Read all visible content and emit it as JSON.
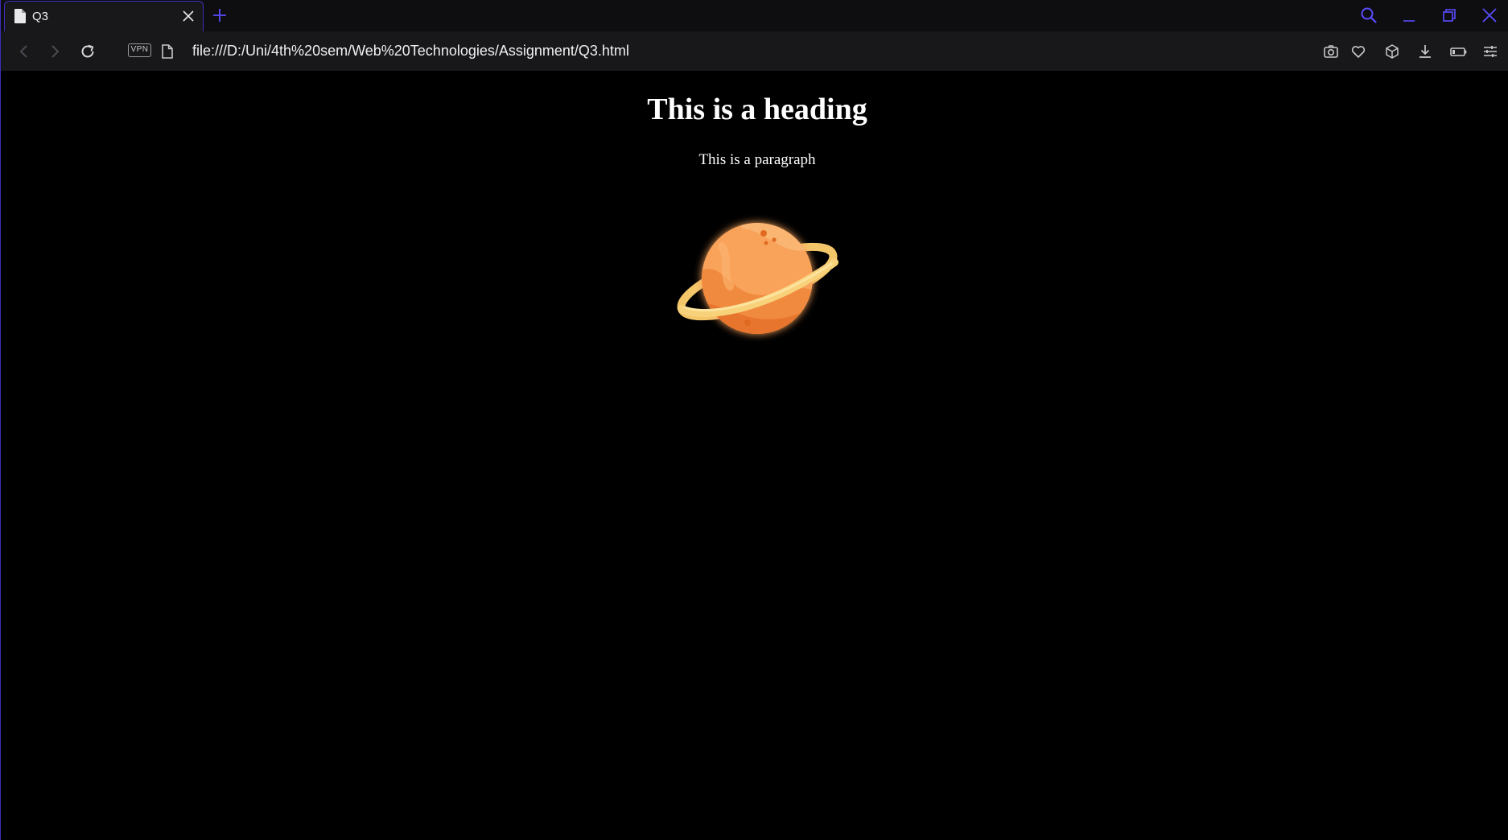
{
  "browser": {
    "tab": {
      "title": "Q3",
      "icon": "file-icon"
    },
    "address_bar": {
      "vpn_label": "VPN",
      "url": "file:///D:/Uni/4th%20sem/Web%20Technologies/Assignment/Q3.html"
    },
    "colors": {
      "accent": "#5a4cff",
      "tab_border": "#3b2fb8",
      "toolbar_bg": "#18181b",
      "tabstrip_bg": "#0e0e10"
    }
  },
  "page": {
    "heading": "This is a heading",
    "paragraph": "This is a paragraph",
    "background": "#000000",
    "text_color": "#ffffff",
    "image": {
      "icon": "planet-with-ring"
    }
  }
}
